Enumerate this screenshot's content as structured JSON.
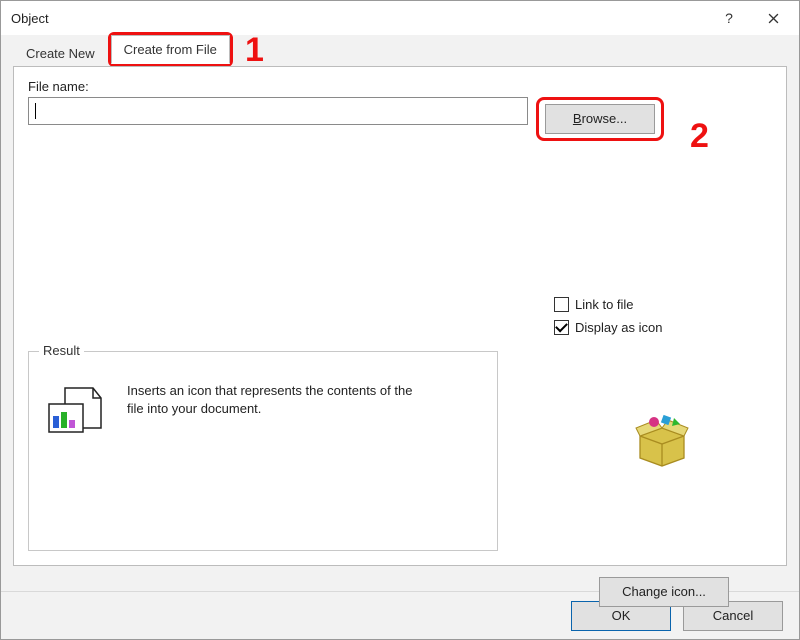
{
  "dialog": {
    "title": "Object",
    "help_symbol": "?"
  },
  "tabs": {
    "create_new": "Create New",
    "create_from_file": "Create from File"
  },
  "file": {
    "label": "File name:",
    "value": "",
    "browse_prefix": "B",
    "browse_rest": "rowse..."
  },
  "checks": {
    "link_prefix": "L",
    "link_rest": "ink to file",
    "display_prefix": "Display ",
    "display_u": "a",
    "display_rest": "s icon"
  },
  "result": {
    "legend": "Result",
    "text": "Inserts an icon that represents the contents of the file into your document."
  },
  "change_icon": {
    "label": "Change icon..."
  },
  "footer": {
    "ok": "OK",
    "cancel": "Cancel"
  },
  "annotations": {
    "one": "1",
    "two": "2"
  }
}
